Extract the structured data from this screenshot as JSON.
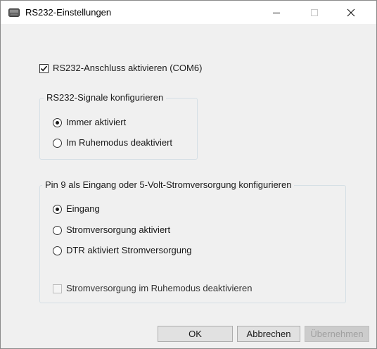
{
  "window": {
    "title": "RS232-Einstellungen",
    "icon": "serial-port-device-icon",
    "controls": [
      "minimize-icon",
      "maximize-icon",
      "close-icon"
    ]
  },
  "enable_port": {
    "label": "RS232-Anschluss aktivieren (COM6)",
    "checked": true
  },
  "signals_group": {
    "title": "RS232-Signale konfigurieren",
    "options": [
      {
        "label": "Immer aktiviert",
        "selected": true
      },
      {
        "label": "Im Ruhemodus deaktiviert",
        "selected": false
      }
    ]
  },
  "pin9_group": {
    "title": "Pin 9 als Eingang oder 5-Volt-Stromversorgung konfigurieren",
    "options": [
      {
        "label": "Eingang",
        "selected": true
      },
      {
        "label": "Stromversorgung aktiviert",
        "selected": false
      },
      {
        "label": "DTR aktiviert Stromversorgung",
        "selected": false
      }
    ],
    "sleep_checkbox": {
      "label": "Stromversorgung im Ruhemodus deaktivieren",
      "checked": false,
      "enabled": false
    }
  },
  "buttons": {
    "ok": "OK",
    "cancel": "Abbrechen",
    "apply": "Übernehmen",
    "apply_enabled": false
  }
}
